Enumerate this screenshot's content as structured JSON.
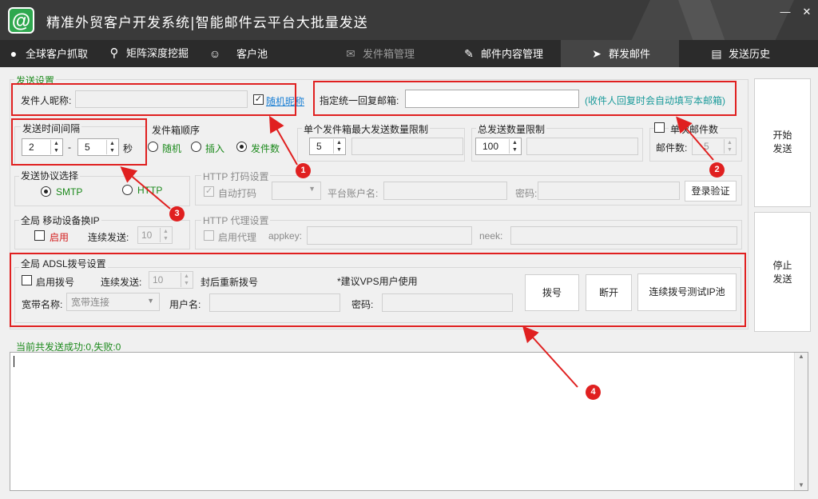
{
  "app": {
    "title": "精准外贸客户开发系统|智能邮件云平台大批量发送",
    "logo_char": "@"
  },
  "window": {
    "minimize": "—",
    "close": "✕"
  },
  "nav": {
    "items": [
      {
        "label": "全球客户抓取",
        "icon": "globe-icon"
      },
      {
        "label": "矩阵深度挖掘",
        "icon": "search-icon"
      },
      {
        "label": "客户池",
        "icon": "users-icon"
      },
      {
        "label": "发件箱管理",
        "icon": "mail-icon"
      },
      {
        "label": "邮件内容管理",
        "icon": "edit-icon"
      },
      {
        "label": "群发邮件",
        "icon": "send-icon"
      },
      {
        "label": "发送历史",
        "icon": "history-icon"
      }
    ],
    "active": "群发邮件"
  },
  "settings": {
    "group_title": "发送设置",
    "sender_nickname_label": "发件人昵称:",
    "sender_nickname_value": "",
    "random_nickname_checked": true,
    "random_nickname_label": "随机昵称",
    "reply_to_label": "指定统一回复邮箱:",
    "reply_to_value": "",
    "reply_to_hint": "(收件人回复时会自动填写本邮箱)",
    "interval": {
      "title": "发送时间间隔",
      "min": "2",
      "dash": "-",
      "max": "5",
      "unit": "秒"
    },
    "order": {
      "title": "发件箱顺序",
      "options": [
        "随机",
        "插入",
        "发件数"
      ],
      "selected": "发件数"
    },
    "per_box_limit": {
      "title": "单个发件箱最大发送数量限制",
      "value": "5"
    },
    "total_limit": {
      "title": "总发送数量限制",
      "value": "100"
    },
    "single_batch": {
      "checked": false,
      "label": "单次邮件数",
      "count_label": "邮件数:",
      "count_value": "5"
    },
    "protocol": {
      "title": "发送协议选择",
      "options": [
        "SMTP",
        "HTTP"
      ],
      "selected": "SMTP"
    },
    "captcha": {
      "title": "HTTP 打码设置",
      "auto_label": "自动打码",
      "auto_checked": true,
      "account_label": "平台账户名:",
      "password_label": "密码:",
      "login_button": "登录验证"
    },
    "mobile_ip": {
      "title": "全局 移动设备换IP",
      "enable_label": "启用",
      "enabled": false,
      "consecutive_label": "连续发送:",
      "consecutive_value": "10"
    },
    "proxy": {
      "title": "HTTP 代理设置",
      "enable_label": "启用代理",
      "enabled": false,
      "appkey_label": "appkey:",
      "neek_label": "neek:"
    },
    "adsl": {
      "title": "全局 ADSL拨号设置",
      "enable_label": "启用拨号",
      "enabled": false,
      "consecutive_label": "连续发送:",
      "consecutive_value": "10",
      "redial_label": "封后重新拨号",
      "vps_hint": "*建议VPS用户使用",
      "broadband_label": "宽带名称:",
      "broadband_value": "宽带连接",
      "username_label": "用户名:",
      "password_label": "密码:",
      "dial_button": "拨号",
      "disconnect_button": "断开",
      "test_button": "连续拨号测试IP池"
    }
  },
  "actions": {
    "start_line1": "开始",
    "start_line2": "发送",
    "stop_line1": "停止",
    "stop_line2": "发送"
  },
  "status": {
    "summary": "当前共发送成功:0,失败:0"
  },
  "annotations": [
    "1",
    "2",
    "3",
    "4"
  ]
}
